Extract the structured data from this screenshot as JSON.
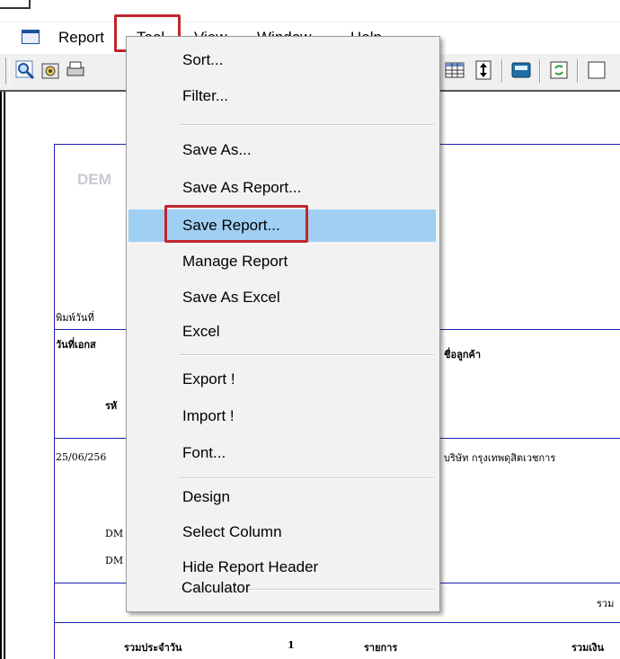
{
  "menubar": {
    "items": [
      "Report",
      "Tool",
      "View",
      "Window",
      "Help"
    ]
  },
  "toolbar": {
    "icons": [
      "preview-icon",
      "settings-icon",
      "printer-icon",
      "grid-icon",
      "resize-icon",
      "calculator-icon",
      "refresh-icon"
    ]
  },
  "dropdown": {
    "items": [
      {
        "label": "Sort..."
      },
      {
        "label": "Filter..."
      },
      {
        "label": "Save As..."
      },
      {
        "label": "Save As Report..."
      },
      {
        "label": "Save Report..."
      },
      {
        "label": "Manage Report"
      },
      {
        "label": "Save As Excel"
      },
      {
        "label": "Excel"
      },
      {
        "label": "Export !"
      },
      {
        "label": "Import !"
      },
      {
        "label": "Font..."
      },
      {
        "label": "Design"
      },
      {
        "label": "Select Column"
      },
      {
        "label": "Hide Report Header"
      },
      {
        "label": "Calculator"
      }
    ],
    "highlighted": "Save Report..."
  },
  "report": {
    "left_fragments": [
      "DEM",
      "พิมพ์วันที่",
      "วันที่เอกส",
      "รหั",
      "25/06/256",
      "DM",
      "DM"
    ],
    "customer_header": "ชื่อลูกค้า",
    "customer_name": "บริษัท กรุงเทพดุสิตเวชการ",
    "sum_fragment": "รวม",
    "footer": {
      "daily_total": "รวมประจำวัน",
      "count": "1",
      "items": "รายการ",
      "amount_total": "รวมเงิน"
    }
  },
  "colors": {
    "highlight_border": "#c0262d",
    "hover_background": "#9fcff3",
    "report_lines": "#1f1fb4"
  }
}
